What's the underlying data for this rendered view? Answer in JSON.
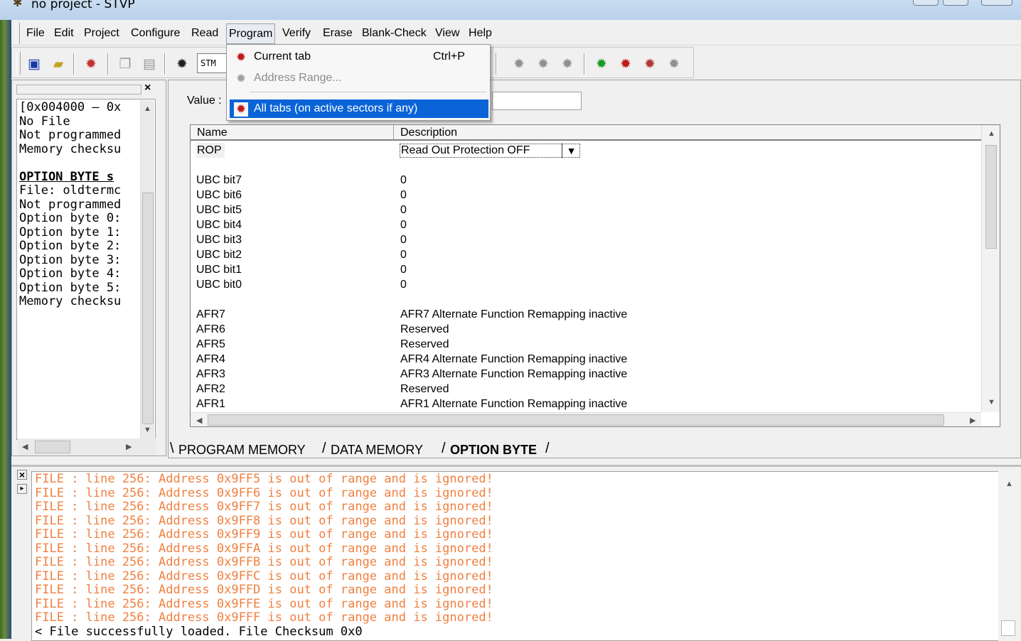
{
  "window": {
    "title": "no project - STVP"
  },
  "menu": {
    "items": [
      "File",
      "Edit",
      "Project",
      "Configure",
      "Read",
      "Program",
      "Verify",
      "Erase",
      "Blank-Check",
      "View",
      "Help"
    ],
    "active": "Program"
  },
  "program_menu": {
    "items": [
      {
        "label": "Current tab",
        "shortcut": "Ctrl+P",
        "state": "normal",
        "icon": "chip-red-icon"
      },
      {
        "label": "Address Range...",
        "shortcut": "",
        "state": "disabled",
        "icon": "chip-grey-icon"
      },
      {
        "label": "All tabs (on active sectors if any)",
        "shortcut": "",
        "state": "highlighted",
        "icon": "chip-red-icon"
      }
    ]
  },
  "toolbar": {
    "device": "STM",
    "icons": [
      "save-icon",
      "open-icon",
      "connect-icon",
      "copy-icon",
      "paste-icon",
      "read-icon",
      "program-icon",
      "verify-icon",
      "erase-icon",
      "blank-check-icon",
      "read-all-icon",
      "program-all-icon",
      "verify-all-icon",
      "erase-all-icon"
    ]
  },
  "left_panel": {
    "lines": [
      {
        "text": "[0x004000 – 0x",
        "bold": false
      },
      {
        "text": "No File",
        "bold": false
      },
      {
        "text": "Not programmed",
        "bold": false
      },
      {
        "text": "Memory checksu",
        "bold": false
      },
      {
        "text": "",
        "bold": false
      },
      {
        "text": "OPTION BYTE s",
        "bold": true
      },
      {
        "text": "File: oldtermc",
        "bold": false
      },
      {
        "text": "Not programmed",
        "bold": false
      },
      {
        "text": "Option byte 0:",
        "bold": false
      },
      {
        "text": "Option byte 1:",
        "bold": false
      },
      {
        "text": "Option byte 2:",
        "bold": false
      },
      {
        "text": "Option byte 3:",
        "bold": false
      },
      {
        "text": "Option byte 4:",
        "bold": false
      },
      {
        "text": "Option byte 5:",
        "bold": false
      },
      {
        "text": "Memory checksu",
        "bold": false
      }
    ]
  },
  "main": {
    "value_label": "Value :",
    "value": "",
    "columns": [
      "Name",
      "Description"
    ],
    "rop": {
      "name": "ROP",
      "value": "Read Out Protection OFF"
    },
    "rows": [
      {
        "name": "",
        "desc": ""
      },
      {
        "name": "UBC bit7",
        "desc": "0"
      },
      {
        "name": "UBC bit6",
        "desc": "0"
      },
      {
        "name": "UBC bit5",
        "desc": "0"
      },
      {
        "name": "UBC bit4",
        "desc": "0"
      },
      {
        "name": "UBC bit3",
        "desc": "0"
      },
      {
        "name": "UBC bit2",
        "desc": "0"
      },
      {
        "name": "UBC bit1",
        "desc": "0"
      },
      {
        "name": "UBC bit0",
        "desc": "0"
      },
      {
        "name": "",
        "desc": ""
      },
      {
        "name": "AFR7",
        "desc": "AFR7 Alternate Function Remapping inactive"
      },
      {
        "name": "AFR6",
        "desc": "Reserved"
      },
      {
        "name": "AFR5",
        "desc": "Reserved"
      },
      {
        "name": "AFR4",
        "desc": "AFR4 Alternate Function Remapping inactive"
      },
      {
        "name": "AFR3",
        "desc": "AFR3 Alternate Function Remapping inactive"
      },
      {
        "name": "AFR2",
        "desc": "Reserved"
      },
      {
        "name": "AFR1",
        "desc": "AFR1 Alternate Function Remapping inactive"
      }
    ],
    "tabs": [
      "PROGRAM MEMORY",
      "DATA MEMORY",
      "OPTION BYTE"
    ],
    "active_tab": "OPTION BYTE"
  },
  "log": {
    "lines": [
      {
        "text": "FILE : line 256: Address 0x9FF5 is out of range and is ignored!",
        "kind": "warn"
      },
      {
        "text": "FILE : line 256: Address 0x9FF6 is out of range and is ignored!",
        "kind": "warn"
      },
      {
        "text": "FILE : line 256: Address 0x9FF7 is out of range and is ignored!",
        "kind": "warn"
      },
      {
        "text": "FILE : line 256: Address 0x9FF8 is out of range and is ignored!",
        "kind": "warn"
      },
      {
        "text": "FILE : line 256: Address 0x9FF9 is out of range and is ignored!",
        "kind": "warn"
      },
      {
        "text": "FILE : line 256: Address 0x9FFA is out of range and is ignored!",
        "kind": "warn"
      },
      {
        "text": "FILE : line 256: Address 0x9FFB is out of range and is ignored!",
        "kind": "warn"
      },
      {
        "text": "FILE : line 256: Address 0x9FFC is out of range and is ignored!",
        "kind": "warn"
      },
      {
        "text": "FILE : line 256: Address 0x9FFD is out of range and is ignored!",
        "kind": "warn"
      },
      {
        "text": "FILE : line 256: Address 0x9FFE is out of range and is ignored!",
        "kind": "warn"
      },
      {
        "text": "FILE : line 256: Address 0x9FFF is out of range and is ignored!",
        "kind": "warn"
      },
      {
        "text": "< File successfully loaded. File Checksum 0x0",
        "kind": "ok"
      }
    ]
  },
  "colors": {
    "warn": "#f08040",
    "highlight": "#0a64d8"
  }
}
